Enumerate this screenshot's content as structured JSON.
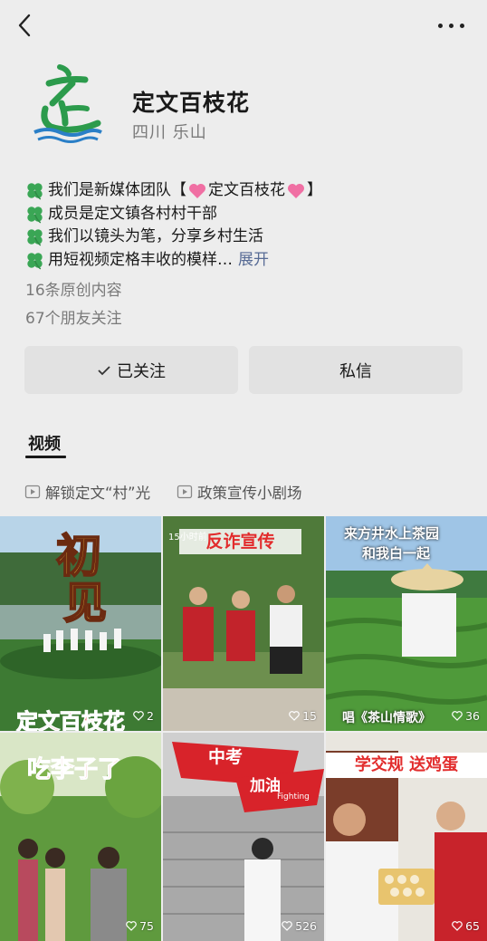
{
  "profile": {
    "name": "定文百枝花",
    "region": "四川 乐山",
    "bio": [
      {
        "pre": "我们是新媒体团队【",
        "mid": "定文百枝花",
        "post": "】"
      },
      {
        "text": "成员是定文镇各村村干部"
      },
      {
        "text": "我们以镜头为笔，分享乡村生活"
      },
      {
        "text": "用短视频定格丰收的模样…",
        "expand": "展开"
      }
    ],
    "original_count": "16条原创内容",
    "friends_follow": "67个朋友关注"
  },
  "actions": {
    "follow": "已关注",
    "message": "私信"
  },
  "tabs": {
    "video": "视频"
  },
  "collections": [
    "解锁定文“村”光",
    "政策宣传小剧场"
  ],
  "videos": [
    {
      "title_top": "初",
      "title_mid": "见",
      "caption": "定文百枝花",
      "likes": "2"
    },
    {
      "badge": "15小时前",
      "title": "反诈宣传",
      "likes": "15"
    },
    {
      "title_l1": "来方井水上茶园",
      "title_l2": "和我白一起",
      "caption": "唱《茶山情歌》",
      "likes": "36"
    },
    {
      "title": "吃李子了",
      "likes": "75"
    },
    {
      "title_a": "中考",
      "title_b": "加油",
      "title_c": "Fighting",
      "likes": "526"
    },
    {
      "title": "学交规 送鸡蛋",
      "likes": "65"
    }
  ],
  "colors": {
    "link": "#576b95",
    "clover": "#3aa655",
    "heart": "#f06fa3"
  }
}
